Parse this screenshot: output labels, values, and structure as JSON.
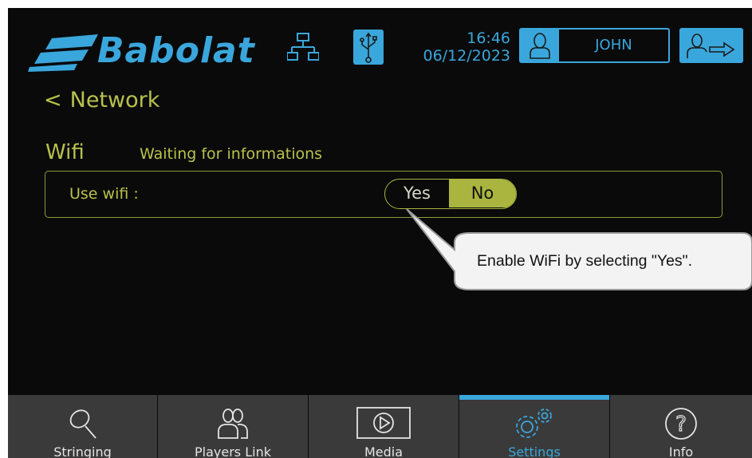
{
  "app": {
    "brand": "Babolat"
  },
  "header": {
    "time": "16:46",
    "date": "06/12/2023",
    "user_name": "JOHN",
    "icons": {
      "network": "network-icon",
      "usb": "usb-icon",
      "user": "user-icon",
      "logout": "logout-icon"
    }
  },
  "page": {
    "back_chevron": "<",
    "title": "Network",
    "section": "Wifi",
    "status": "Waiting for informations",
    "wifi_label": "Use wifi :",
    "toggle": {
      "yes": "Yes",
      "no": "No",
      "selected": "No"
    }
  },
  "tooltip": {
    "text": "Enable WiFi by selecting \"Yes\"."
  },
  "nav": {
    "items": [
      {
        "label": "Stringing",
        "icon": "racket-icon"
      },
      {
        "label": "Players Link",
        "icon": "players-icon"
      },
      {
        "label": "Media",
        "icon": "play-icon"
      },
      {
        "label": "Settings",
        "icon": "gears-icon"
      },
      {
        "label": "Info",
        "icon": "help-icon"
      }
    ],
    "active": "Settings"
  },
  "colors": {
    "accent_blue": "#3aa7dc",
    "accent_green": "#a9b53f",
    "background": "#0a0a0a",
    "nav_bg": "#3a3a3a"
  }
}
